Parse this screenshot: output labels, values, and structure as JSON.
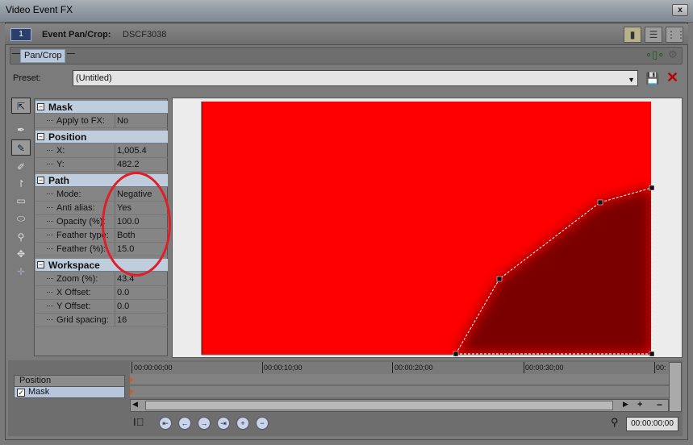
{
  "window": {
    "title": "Video Event FX",
    "close_glyph": "x"
  },
  "header": {
    "event_index": "1",
    "label": "Event Pan/Crop:",
    "event_name": "DSCF3038"
  },
  "chain": {
    "plugin_label": "Pan/Crop"
  },
  "preset": {
    "label": "Preset:",
    "value": "(Untitled)"
  },
  "properties": {
    "mask": {
      "title": "Mask",
      "rows": [
        {
          "key": "Apply to FX:",
          "value": "No"
        }
      ]
    },
    "position": {
      "title": "Position",
      "rows": [
        {
          "key": "X:",
          "value": "1,005.4"
        },
        {
          "key": "Y:",
          "value": "482.2"
        }
      ]
    },
    "path": {
      "title": "Path",
      "rows": [
        {
          "key": "Mode:",
          "value": "Negative"
        },
        {
          "key": "Anti alias:",
          "value": "Yes"
        },
        {
          "key": "Opacity (%):",
          "value": "100.0"
        },
        {
          "key": "Feather type:",
          "value": "Both"
        },
        {
          "key": "Feather (%):",
          "value": "15.0"
        }
      ]
    },
    "workspace": {
      "title": "Workspace",
      "rows": [
        {
          "key": "Zoom (%):",
          "value": "43.4"
        },
        {
          "key": "X Offset:",
          "value": "0.0"
        },
        {
          "key": "Y Offset:",
          "value": "0.0"
        },
        {
          "key": "Grid spacing:",
          "value": "16"
        }
      ]
    }
  },
  "tracks": [
    {
      "label": "Position",
      "checked": false
    },
    {
      "label": "Mask",
      "checked": true
    }
  ],
  "timeline": {
    "ticks": [
      "00:00:00;00",
      "00:00:10;00",
      "00:00:20;00",
      "00:00:30;00",
      "00:"
    ],
    "current_time": "00:00:00;00"
  },
  "colors": {
    "mask_fill": "#ff0000",
    "mask_dark": "#7a0000",
    "annotation": "#e01e2a"
  }
}
